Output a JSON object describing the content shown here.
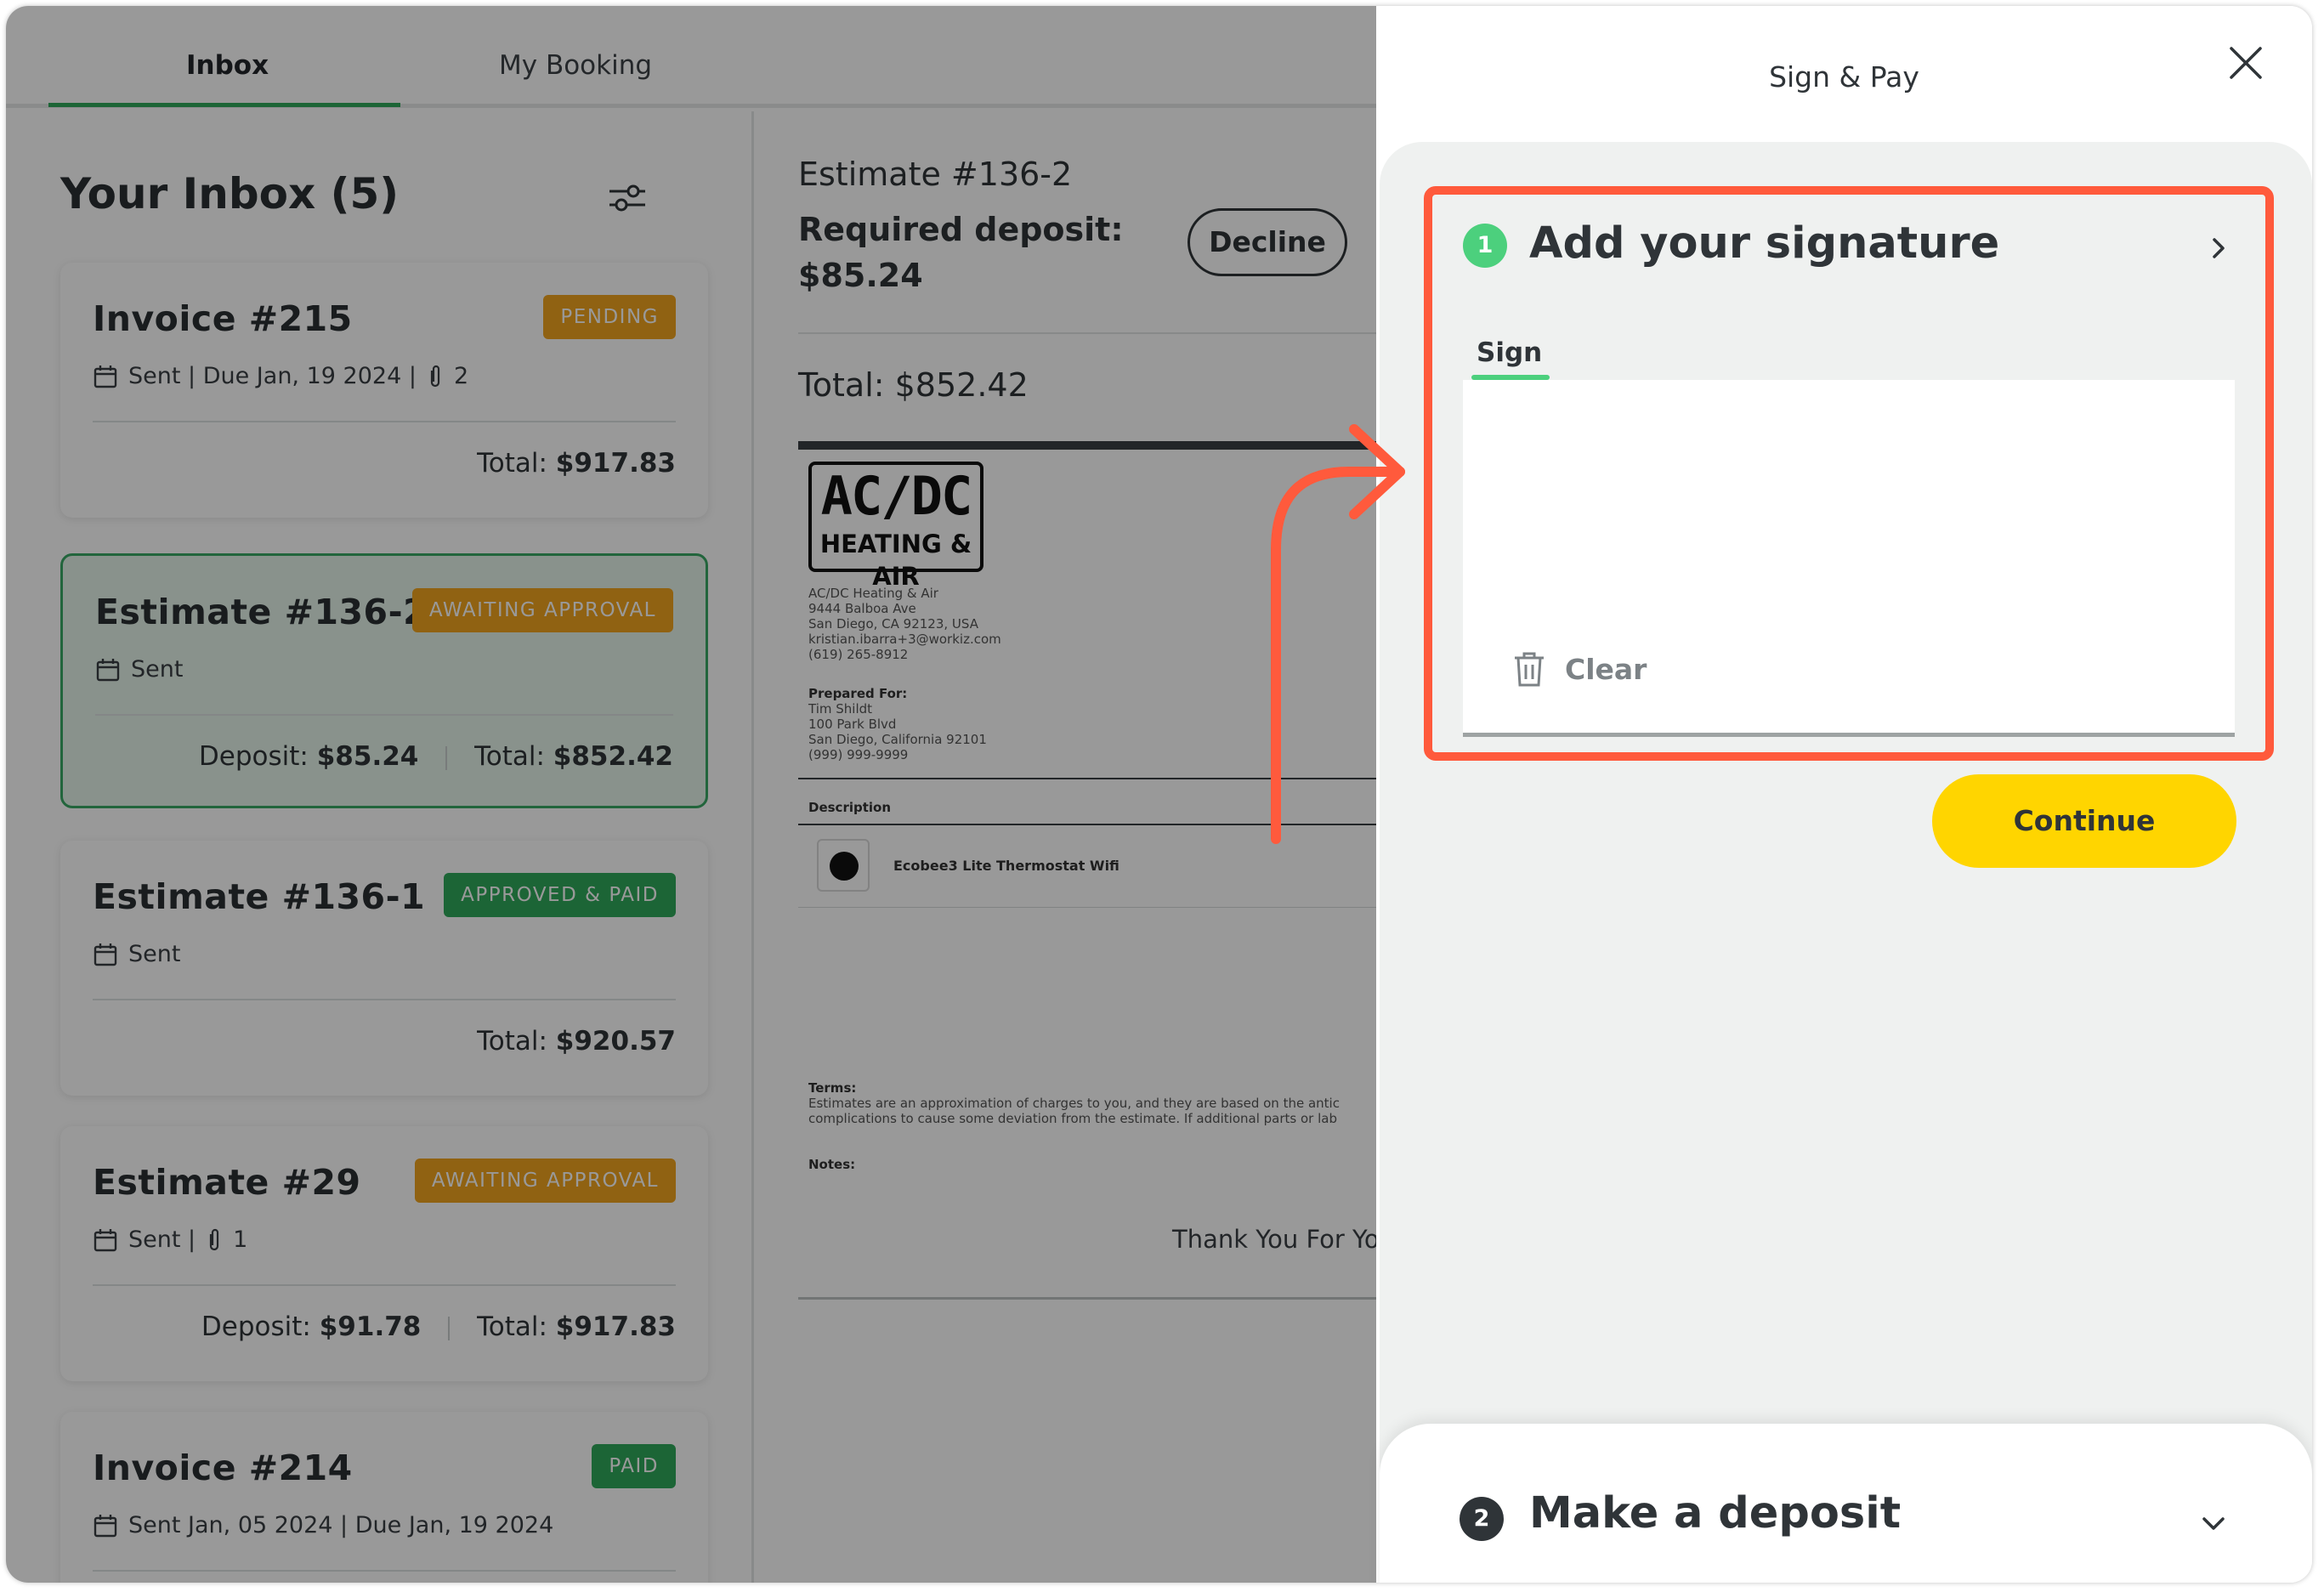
{
  "tabs": {
    "inbox": "Inbox",
    "booking": "My Booking"
  },
  "inbox": {
    "title": "Your Inbox (5)",
    "cards": [
      {
        "title": "Invoice #215",
        "badge": "PENDING",
        "meta": "Sent | Due Jan, 19 2024 |",
        "attachments": "2",
        "total_label": "Total:",
        "total": "$917.83"
      },
      {
        "title": "Estimate #136-2",
        "badge": "AWAITING APPROVAL",
        "meta": "Sent",
        "deposit_label": "Deposit:",
        "deposit": "$85.24",
        "total_label": "Total:",
        "total": "$852.42"
      },
      {
        "title": "Estimate #136-1",
        "badge": "APPROVED & PAID",
        "meta": "Sent",
        "total_label": "Total:",
        "total": "$920.57"
      },
      {
        "title": "Estimate #29",
        "badge": "AWAITING APPROVAL",
        "meta": "Sent |",
        "attachments": "1",
        "deposit_label": "Deposit:",
        "deposit": "$91.78",
        "total_label": "Total:",
        "total": "$917.83"
      },
      {
        "title": "Invoice #214",
        "badge": "PAID",
        "meta": "Sent Jan, 05 2024 | Due Jan, 19 2024"
      }
    ]
  },
  "detail": {
    "title": "Estimate #136-2",
    "required_deposit_label": "Required deposit:",
    "required_deposit": "$85.24",
    "decline": "Decline",
    "total": "Total: $852.42",
    "doc": {
      "logo_line1": "AC/DC",
      "logo_line2": "HEATING & AIR",
      "company": [
        "AC/DC Heating & Air",
        "9444 Balboa Ave",
        "San Diego, CA 92123, USA",
        "kristian.ibarra+3@workiz.com",
        "(619) 265-8912"
      ],
      "prepared_for_label": "Prepared For:",
      "prepared_for": [
        "Tim Shildt",
        "100 Park Blvd",
        "San Diego, California 92101",
        "(999) 999-9999"
      ],
      "description_header": "Description",
      "item": "Ecobee3 Lite Thermostat Wifi",
      "terms_label": "Terms:",
      "terms": [
        "Estimates are an approximation of charges to you, and they are based on the antic",
        "complications to cause some deviation from the estimate.  If additional parts or lab"
      ],
      "notes_label": "Notes:",
      "thanks": "Thank You For Yo"
    }
  },
  "panel": {
    "title": "Sign & Pay",
    "step1": {
      "number": "1",
      "title": "Add your signature",
      "tab": "Sign",
      "clear": "Clear"
    },
    "continue": "Continue",
    "step2": {
      "number": "2",
      "title": "Make a deposit"
    }
  },
  "colors": {
    "accent_green": "#2fa85a",
    "badge_orange": "#f0a41e",
    "continue_yellow": "#ffd500",
    "annotation_red": "#ff5a3c",
    "step_green": "#4cd07d"
  }
}
